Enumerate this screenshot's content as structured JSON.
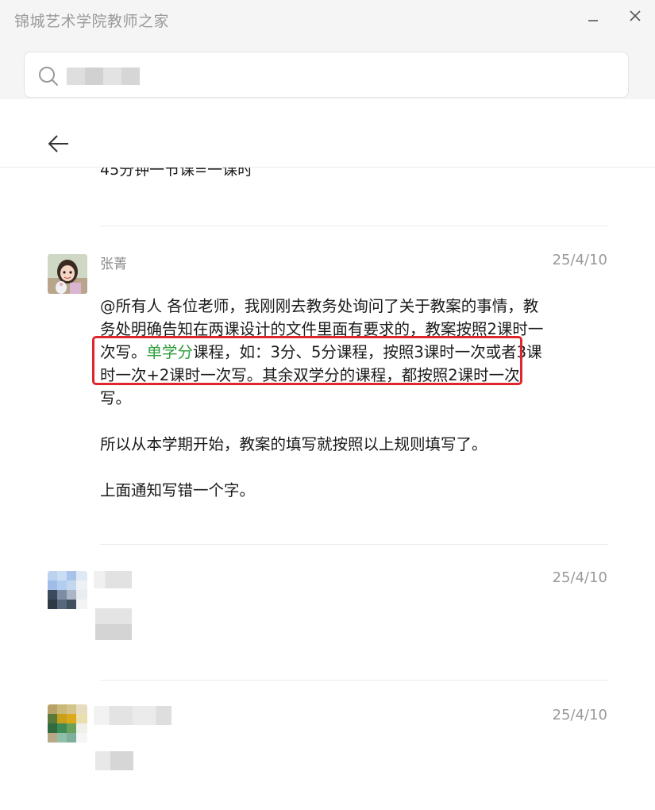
{
  "window": {
    "title": "锦城艺术学院教师之家",
    "minimize_glyph": "—",
    "close_glyph": "✕"
  },
  "search": {
    "icon": "search-icon",
    "value_pixelated": true
  },
  "nav": {
    "back_icon": "arrow-left-icon"
  },
  "feed": {
    "partial_previous_line": "45分钟一节课=一课时",
    "messages": [
      {
        "sender": "张菁",
        "timestamp": "25/4/10",
        "paragraphs": [
          {
            "segments": [
              {
                "text": "@所有人  各位老师，我刚刚去教务处询问了关于教案的事情，教务处明确告知在两课设计的文件里面有要求的，教案按照2课时一次写。"
              },
              {
                "text": "单学分",
                "color": "#2e9d3c"
              },
              {
                "text": "课程，如：3分、5分课程，按照3课时一次或者3课时一次+2课时一次写。其余双学分的课程，都按照2课时一次写。"
              }
            ]
          },
          {
            "segments": [
              {
                "text": "所以从本学期开始，教案的填写就按照以上规则填写了。"
              }
            ]
          },
          {
            "segments": [
              {
                "text": "上面通知写错一个字。"
              }
            ]
          }
        ],
        "highlighted": true
      },
      {
        "sender_pixelated": true,
        "timestamp": "25/4/10"
      },
      {
        "sender_pixelated": true,
        "timestamp": "25/4/10"
      }
    ]
  },
  "colors": {
    "accent_green": "#2e9d3c",
    "highlight_red": "#e0262b"
  }
}
